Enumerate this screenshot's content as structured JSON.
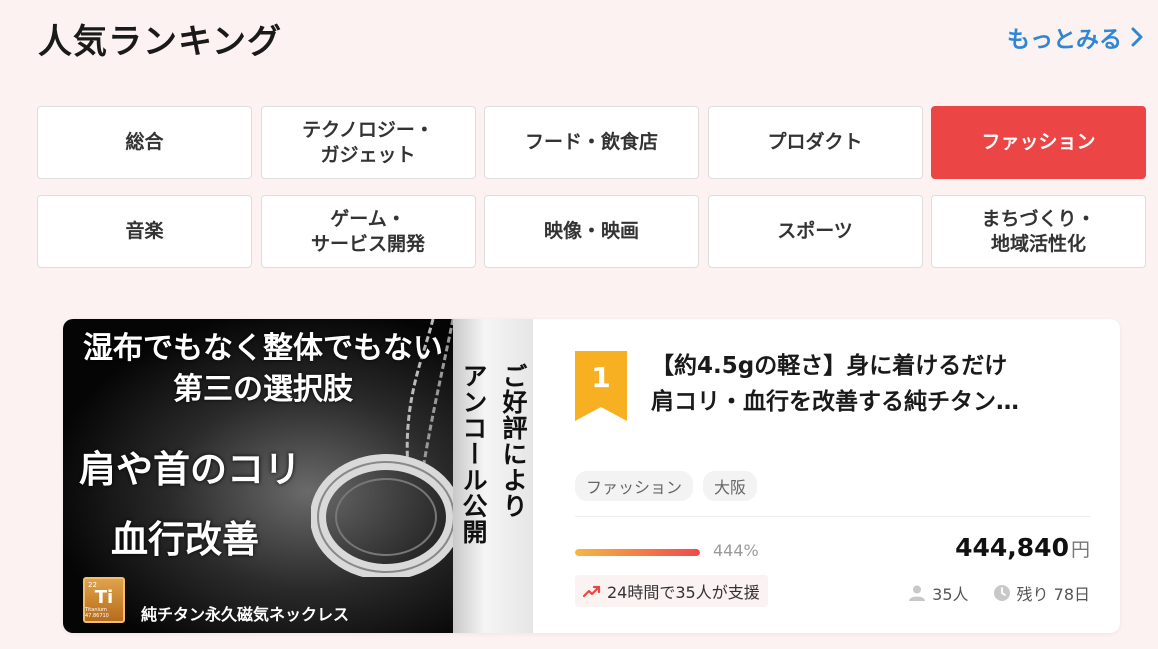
{
  "header": {
    "title": "人気ランキング",
    "more_label": "もっとみる"
  },
  "categories": [
    {
      "label": "総合",
      "active": false
    },
    {
      "label": "テクノロジー・\nガジェット",
      "active": false
    },
    {
      "label": "フード・飲食店",
      "active": false
    },
    {
      "label": "プロダクト",
      "active": false
    },
    {
      "label": "ファッション",
      "active": true
    },
    {
      "label": "音楽",
      "active": false
    },
    {
      "label": "ゲーム・\nサービス開発",
      "active": false
    },
    {
      "label": "映像・映画",
      "active": false
    },
    {
      "label": "スポーツ",
      "active": false
    },
    {
      "label": "まちづくり・\n地域活性化",
      "active": false
    }
  ],
  "card": {
    "image": {
      "headline_1": "湿布でもなく整体でもない",
      "headline_2": "第三の選択肢",
      "big_1": "肩や首のコリ",
      "big_2": "血行改善",
      "vertical_1": "ご好評により",
      "vertical_2": "アンコール公開",
      "element_number": "22",
      "element_symbol": "Ti",
      "element_sub": "Titanium 47.86710",
      "caption": "純チタン永久磁気ネックレス"
    },
    "rank": "1",
    "title_line_1": "【約4.5gの軽さ】身に着けるだけ",
    "title_line_2": "肩コリ・血行を改善する純チタン…",
    "tags": [
      "ファッション",
      "大阪"
    ],
    "progress_percent": 444,
    "progress_label": "444%",
    "amount": "444,840",
    "currency": "円",
    "support_text": "24時間で35人が支援",
    "supporters": "35人",
    "remaining": "残り 78日"
  },
  "colors": {
    "accent": "#ec4546",
    "link": "#2f86d6",
    "rank_badge": "#f6b021",
    "background": "#fcf2f2"
  }
}
